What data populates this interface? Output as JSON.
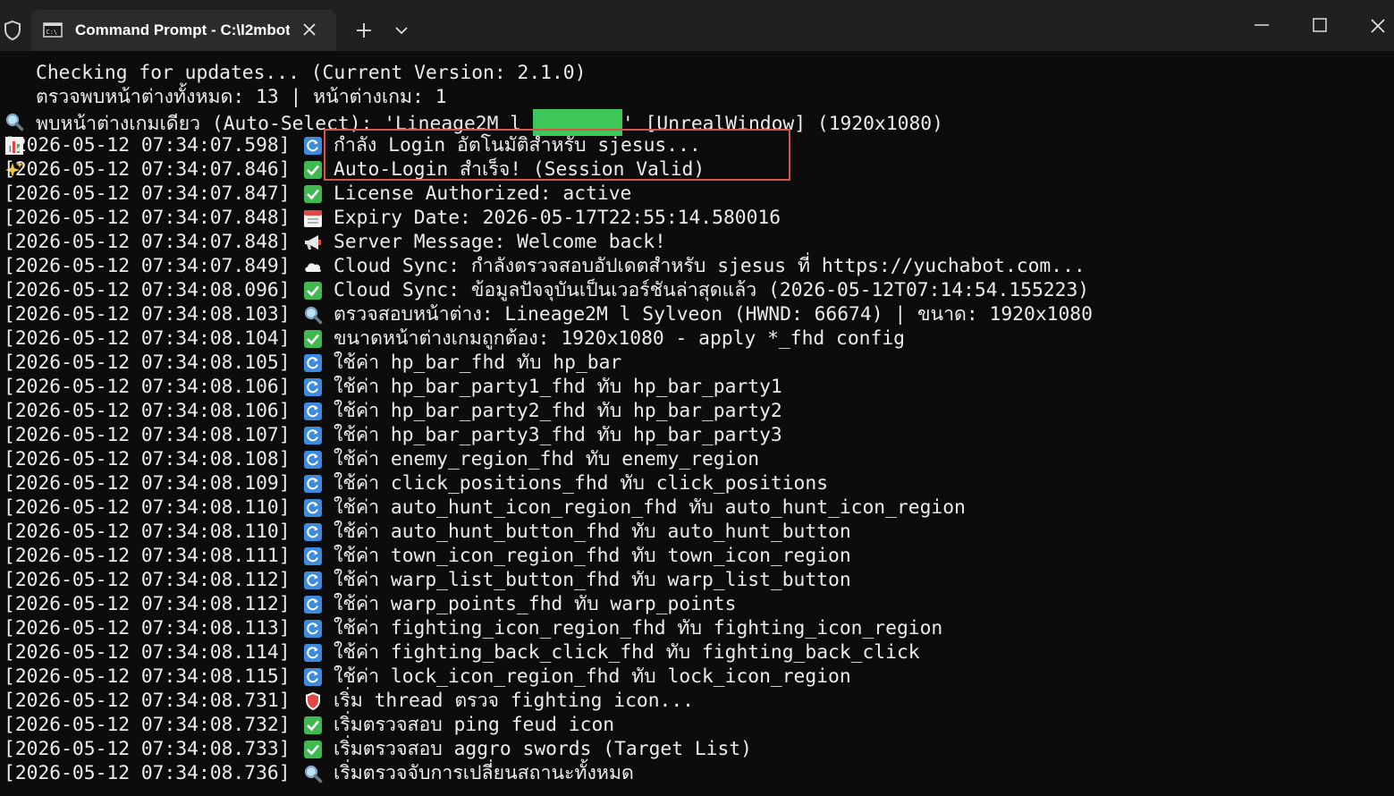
{
  "window": {
    "tab_title": "Command Prompt - C:\\l2mbot",
    "tab_icon": "cmd-icon",
    "accent_highlight": "#d9534a"
  },
  "console": {
    "header_lines": [
      {
        "icon": "magnifier-icon",
        "text": "Checking for updates... (Current Version: 2.1.0)"
      },
      {
        "icon": "bar-chart-icon",
        "text": "ตรวจพบหน้าต่างทั้งหมด: 13 | หน้าต่างเกม: 1"
      },
      {
        "icon": "sparkles-icon",
        "text_before": "พบหน้าต่างเกมเดียว (Auto-Select): 'Lineage2M l ",
        "text_after": "' [UnrealWindow] (1920x1080)"
      }
    ],
    "log_lines": [
      {
        "time": "[2026-05-12 07:34:07.598]",
        "icon": "refresh-icon",
        "text": "กำลัง Login อัตโนมัติสำหรับ sjesus..."
      },
      {
        "time": "[2026-05-12 07:34:07.846]",
        "icon": "check-icon",
        "text": "Auto-Login สำเร็จ! (Session Valid)"
      },
      {
        "time": "[2026-05-12 07:34:07.847]",
        "icon": "check-icon",
        "text": "License Authorized: active"
      },
      {
        "time": "[2026-05-12 07:34:07.848]",
        "icon": "calendar-icon",
        "text": "Expiry Date: 2026-05-17T22:55:14.580016"
      },
      {
        "time": "[2026-05-12 07:34:07.848]",
        "icon": "megaphone-icon",
        "text": "Server Message: Welcome back!"
      },
      {
        "time": "[2026-05-12 07:34:07.849]",
        "icon": "cloud-icon",
        "text": "Cloud Sync: กำลังตรวจสอบอัปเดตสำหรับ sjesus ที่ https://yuchabot.com..."
      },
      {
        "time": "[2026-05-12 07:34:08.096]",
        "icon": "check-icon",
        "text": "Cloud Sync: ข้อมูลปัจจุบันเป็นเวอร์ชันล่าสุดแล้ว (2026-05-12T07:14:54.155223)"
      },
      {
        "time": "[2026-05-12 07:34:08.103]",
        "icon": "magnifier-icon",
        "text": "ตรวจสอบหน้าต่าง: Lineage2M l Sylveon (HWND: 66674) | ขนาด: 1920x1080"
      },
      {
        "time": "[2026-05-12 07:34:08.104]",
        "icon": "check-icon",
        "text": "ขนาดหน้าต่างเกมถูกต้อง: 1920x1080 - apply *_fhd config"
      },
      {
        "time": "[2026-05-12 07:34:08.105]",
        "icon": "refresh-icon",
        "text": "ใช้ค่า hp_bar_fhd ทับ hp_bar"
      },
      {
        "time": "[2026-05-12 07:34:08.106]",
        "icon": "refresh-icon",
        "text": "ใช้ค่า hp_bar_party1_fhd ทับ hp_bar_party1"
      },
      {
        "time": "[2026-05-12 07:34:08.106]",
        "icon": "refresh-icon",
        "text": "ใช้ค่า hp_bar_party2_fhd ทับ hp_bar_party2"
      },
      {
        "time": "[2026-05-12 07:34:08.107]",
        "icon": "refresh-icon",
        "text": "ใช้ค่า hp_bar_party3_fhd ทับ hp_bar_party3"
      },
      {
        "time": "[2026-05-12 07:34:08.108]",
        "icon": "refresh-icon",
        "text": "ใช้ค่า enemy_region_fhd ทับ enemy_region"
      },
      {
        "time": "[2026-05-12 07:34:08.109]",
        "icon": "refresh-icon",
        "text": "ใช้ค่า click_positions_fhd ทับ click_positions"
      },
      {
        "time": "[2026-05-12 07:34:08.110]",
        "icon": "refresh-icon",
        "text": "ใช้ค่า auto_hunt_icon_region_fhd ทับ auto_hunt_icon_region"
      },
      {
        "time": "[2026-05-12 07:34:08.110]",
        "icon": "refresh-icon",
        "text": "ใช้ค่า auto_hunt_button_fhd ทับ auto_hunt_button"
      },
      {
        "time": "[2026-05-12 07:34:08.111]",
        "icon": "refresh-icon",
        "text": "ใช้ค่า town_icon_region_fhd ทับ town_icon_region"
      },
      {
        "time": "[2026-05-12 07:34:08.112]",
        "icon": "refresh-icon",
        "text": "ใช้ค่า warp_list_button_fhd ทับ warp_list_button"
      },
      {
        "time": "[2026-05-12 07:34:08.112]",
        "icon": "refresh-icon",
        "text": "ใช้ค่า warp_points_fhd ทับ warp_points"
      },
      {
        "time": "[2026-05-12 07:34:08.113]",
        "icon": "refresh-icon",
        "text": "ใช้ค่า fighting_icon_region_fhd ทับ fighting_icon_region"
      },
      {
        "time": "[2026-05-12 07:34:08.114]",
        "icon": "refresh-icon",
        "text": "ใช้ค่า fighting_back_click_fhd ทับ fighting_back_click"
      },
      {
        "time": "[2026-05-12 07:34:08.115]",
        "icon": "refresh-icon",
        "text": "ใช้ค่า lock_icon_region_fhd ทับ lock_icon_region"
      },
      {
        "time": "[2026-05-12 07:34:08.731]",
        "icon": "shield-icon",
        "text": "เริ่ม thread ตรวจ fighting icon..."
      },
      {
        "time": "[2026-05-12 07:34:08.732]",
        "icon": "check-icon",
        "text": "เริ่มตรวจสอบ ping feud icon"
      },
      {
        "time": "[2026-05-12 07:34:08.733]",
        "icon": "check-icon",
        "text": "เริ่มตรวจสอบ aggro swords (Target List)"
      },
      {
        "time": "[2026-05-12 07:34:08.736]",
        "icon": "magnifier-icon",
        "text": "เริ่มตรวจจับการเปลี่ยนสถานะทั้งหมด"
      }
    ]
  }
}
